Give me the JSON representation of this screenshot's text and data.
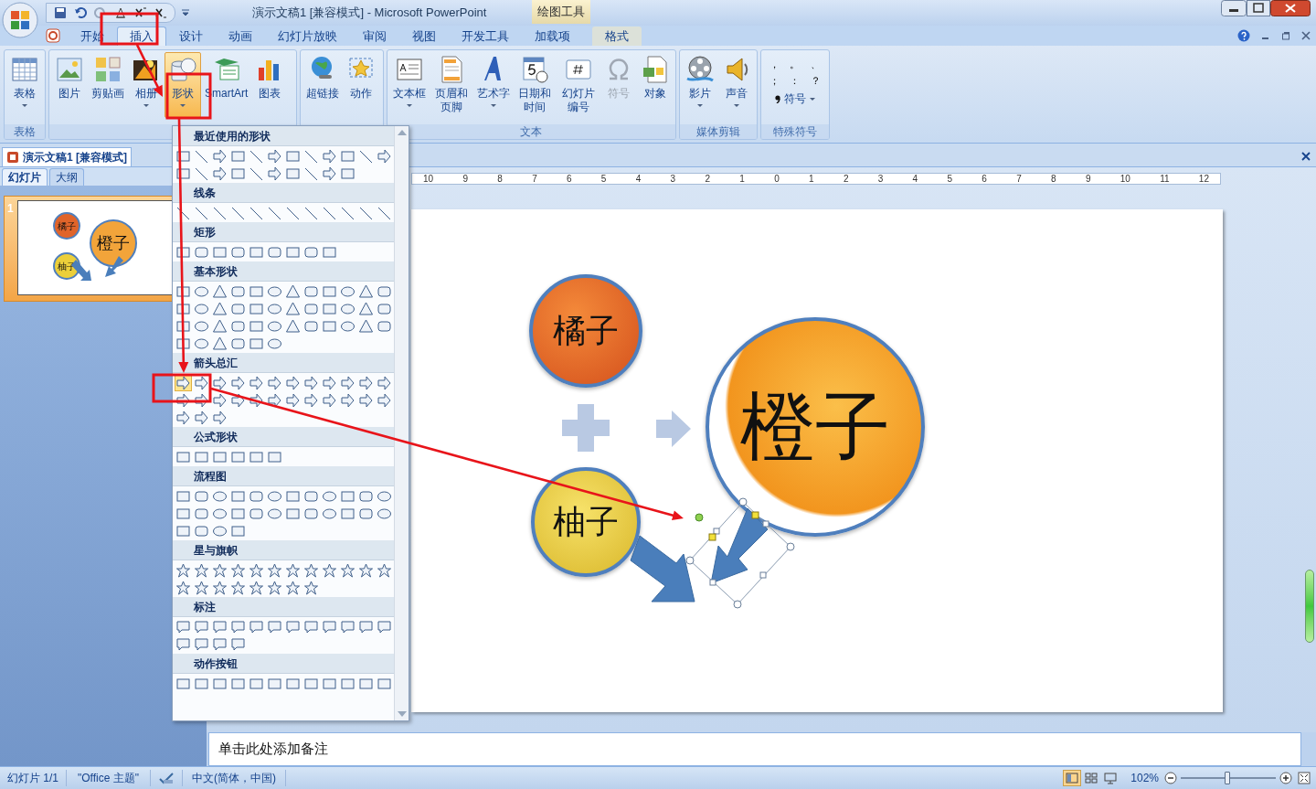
{
  "window": {
    "title": "演示文稿1 [兼容模式] - Microsoft PowerPoint",
    "context_group": "绘图工具"
  },
  "tabs": [
    {
      "label": "开始",
      "selected": false,
      "contextual": false
    },
    {
      "label": "插入",
      "selected": true,
      "contextual": false
    },
    {
      "label": "设计",
      "selected": false,
      "contextual": false
    },
    {
      "label": "动画",
      "selected": false,
      "contextual": false
    },
    {
      "label": "幻灯片放映",
      "selected": false,
      "contextual": false
    },
    {
      "label": "审阅",
      "selected": false,
      "contextual": false
    },
    {
      "label": "视图",
      "selected": false,
      "contextual": false
    },
    {
      "label": "开发工具",
      "selected": false,
      "contextual": false
    },
    {
      "label": "加载项",
      "selected": false,
      "contextual": false
    },
    {
      "label": "格式",
      "selected": false,
      "contextual": true
    }
  ],
  "ribbon": {
    "groups": [
      {
        "label": "表格",
        "buttons": [
          {
            "label": "表格",
            "kind": "table",
            "dropdown": true,
            "selected": false,
            "disabled": false
          }
        ]
      },
      {
        "buttons": [
          {
            "label": "图片",
            "kind": "picture",
            "dropdown": false,
            "selected": false,
            "disabled": false
          },
          {
            "label": "剪贴画",
            "kind": "clipart",
            "dropdown": false,
            "selected": false,
            "disabled": false
          },
          {
            "label": "相册",
            "kind": "album",
            "dropdown": true,
            "selected": false,
            "disabled": false
          },
          {
            "label": "形状",
            "kind": "shapes",
            "dropdown": true,
            "selected": true,
            "disabled": false
          },
          {
            "label": "SmartArt",
            "kind": "smartart",
            "dropdown": false,
            "selected": false,
            "disabled": false
          },
          {
            "label": "图表",
            "kind": "chart",
            "dropdown": false,
            "selected": false,
            "disabled": false
          }
        ]
      },
      {
        "buttons": [
          {
            "label": "超链接",
            "kind": "hyperlink",
            "dropdown": false,
            "selected": false,
            "disabled": false
          },
          {
            "label": "动作",
            "kind": "action",
            "dropdown": false,
            "selected": false,
            "disabled": false
          }
        ]
      },
      {
        "label": "文本",
        "buttons": [
          {
            "label": "文本框",
            "kind": "textbox",
            "dropdown": true,
            "selected": false,
            "disabled": false
          },
          {
            "label": "页眉和页脚",
            "kind": "header",
            "dropdown": false,
            "selected": false,
            "disabled": false
          },
          {
            "label": "艺术字",
            "kind": "wordart",
            "dropdown": true,
            "selected": false,
            "disabled": false
          },
          {
            "label": "日期和时间",
            "kind": "datetime",
            "dropdown": false,
            "selected": false,
            "disabled": false
          },
          {
            "label": "幻灯片编号",
            "kind": "slidenum",
            "dropdown": false,
            "selected": false,
            "disabled": false
          },
          {
            "label": "符号",
            "kind": "omega",
            "dropdown": false,
            "selected": false,
            "disabled": true
          },
          {
            "label": "对象",
            "kind": "object",
            "dropdown": false,
            "selected": false,
            "disabled": false
          }
        ]
      },
      {
        "label": "媒体剪辑",
        "buttons": [
          {
            "label": "影片",
            "kind": "movie",
            "dropdown": true,
            "selected": false,
            "disabled": false
          },
          {
            "label": "声音",
            "kind": "sound",
            "dropdown": true,
            "selected": false,
            "disabled": false
          }
        ]
      }
    ],
    "special_symbols": {
      "label": "特殊符号",
      "symbols": [
        "，",
        "。",
        "、",
        "；",
        "：",
        "？"
      ],
      "button": "符号"
    }
  },
  "document_tab": {
    "title": "演示文稿1 [兼容模式]"
  },
  "pane_tabs": [
    {
      "label": "幻灯片",
      "selected": true
    },
    {
      "label": "大纲",
      "selected": false
    }
  ],
  "thumbnails": [
    {
      "number": "1",
      "selected": true,
      "labels": [
        "橘子",
        "橙子",
        "柚子"
      ]
    }
  ],
  "ruler": {
    "labels": [
      "10",
      "9",
      "8",
      "7",
      "6",
      "5",
      "4",
      "3",
      "2",
      "1",
      "0",
      "1",
      "2",
      "3",
      "4",
      "5",
      "6",
      "7",
      "8",
      "9",
      "10",
      "11",
      "12"
    ]
  },
  "slide": {
    "shapes": [
      {
        "kind": "tangerine",
        "text": "橘子"
      },
      {
        "kind": "orange",
        "text": "橙子"
      },
      {
        "kind": "pomelo",
        "text": "柚子"
      }
    ]
  },
  "shape_menu": {
    "sections": [
      {
        "title": "最近使用的形状",
        "first_highlighted": false
      },
      {
        "title": "线条",
        "first_highlighted": false
      },
      {
        "title": "矩形",
        "first_highlighted": false
      },
      {
        "title": "基本形状",
        "first_highlighted": false
      },
      {
        "title": "箭头总汇",
        "first_highlighted": true
      },
      {
        "title": "公式形状",
        "first_highlighted": false
      },
      {
        "title": "流程图",
        "first_highlighted": false
      },
      {
        "title": "星与旗帜",
        "first_highlighted": false
      },
      {
        "title": "标注",
        "first_highlighted": false
      },
      {
        "title": "动作按钮",
        "first_highlighted": false
      }
    ]
  },
  "notes": {
    "placeholder": "单击此处添加备注"
  },
  "status_bar": {
    "slide_counter": "幻灯片 1/1",
    "theme": "\"Office 主题\"",
    "language": "中文(简体，中国)",
    "views": [
      {
        "kind": "normal",
        "selected": true
      },
      {
        "kind": "sorter",
        "selected": false
      },
      {
        "kind": "show",
        "selected": false
      }
    ],
    "zoom": {
      "reading": "102%",
      "level": 0.49
    }
  }
}
